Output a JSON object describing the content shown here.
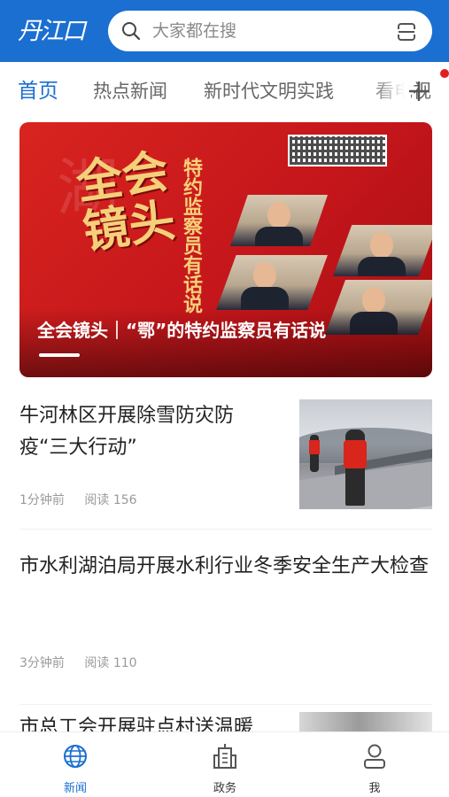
{
  "header": {
    "logo_text": "丹江口",
    "search_placeholder": "大家都在搜",
    "search_icon": "search-icon",
    "scan_icon": "scan-icon"
  },
  "tabs": [
    {
      "label": "首页",
      "active": true
    },
    {
      "label": "热点新闻",
      "active": false
    },
    {
      "label": "新时代文明实践",
      "active": false
    },
    {
      "label": "看电视",
      "active": false
    }
  ],
  "banner": {
    "art_title": "全会镜头",
    "art_side": "特约监察员有话说",
    "caption": "全会镜头｜“鄂”的特约监察员有话说"
  },
  "news": [
    {
      "title": "牛河林区开展除雪防灾防疫“三大行动”",
      "time": "1分钟前",
      "reads": "阅读 156",
      "has_image": true
    },
    {
      "title": "市水利湖泊局开展水利行业冬季安全生产大检查",
      "time": "3分钟前",
      "reads": "阅读 110",
      "has_image": false
    },
    {
      "title": "市总工会开展驻点村送温暖",
      "has_image": true
    }
  ],
  "tabbar": [
    {
      "label": "新闻",
      "icon": "globe-icon",
      "active": true
    },
    {
      "label": "政务",
      "icon": "building-icon",
      "active": false
    },
    {
      "label": "我",
      "icon": "user-icon",
      "active": false
    }
  ],
  "colors": {
    "brand": "#1a6fd1",
    "banner_red": "#c4161b",
    "badge_red": "#e02020"
  }
}
